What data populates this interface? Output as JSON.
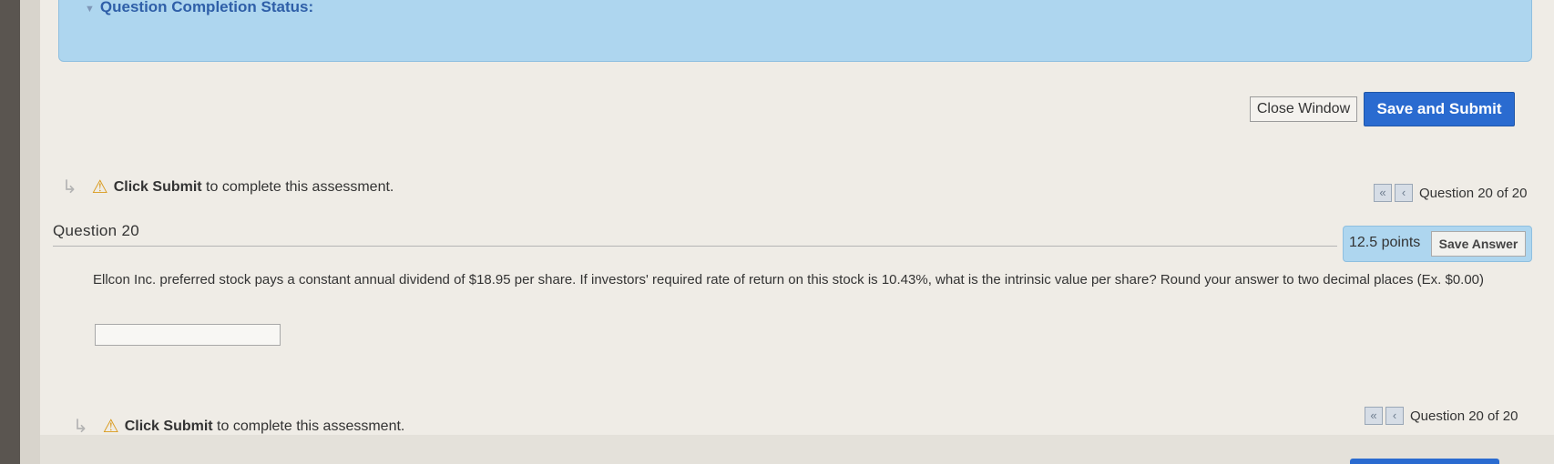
{
  "status": {
    "title": "Question Completion Status:"
  },
  "actions": {
    "close_label": "Close Window",
    "submit_label": "Save and Submit"
  },
  "notice": {
    "bold": "Click Submit",
    "rest": " to complete this assessment."
  },
  "navigation": {
    "position": "Question 20 of 20",
    "first_glyph": "«",
    "prev_glyph": "‹"
  },
  "question": {
    "title": "Question 20",
    "points": "12.5 points",
    "save_label": "Save Answer",
    "text": "Ellcon Inc. preferred stock pays a constant annual dividend of $18.95 per share. If investors' required rate of return on this stock is 10.43%, what is the intrinsic value per share? Round your answer to two decimal places (Ex. $0.00)",
    "answer_value": ""
  },
  "icons": {
    "arrow": "arrow-return-icon",
    "warning": "warning-icon",
    "collapse": "collapse-chevron-icon"
  },
  "colors": {
    "accent": "#2a6bd0",
    "status_bg": "#aed6ef",
    "title_color": "#2f5fa8",
    "warning": "#d99a1c"
  }
}
